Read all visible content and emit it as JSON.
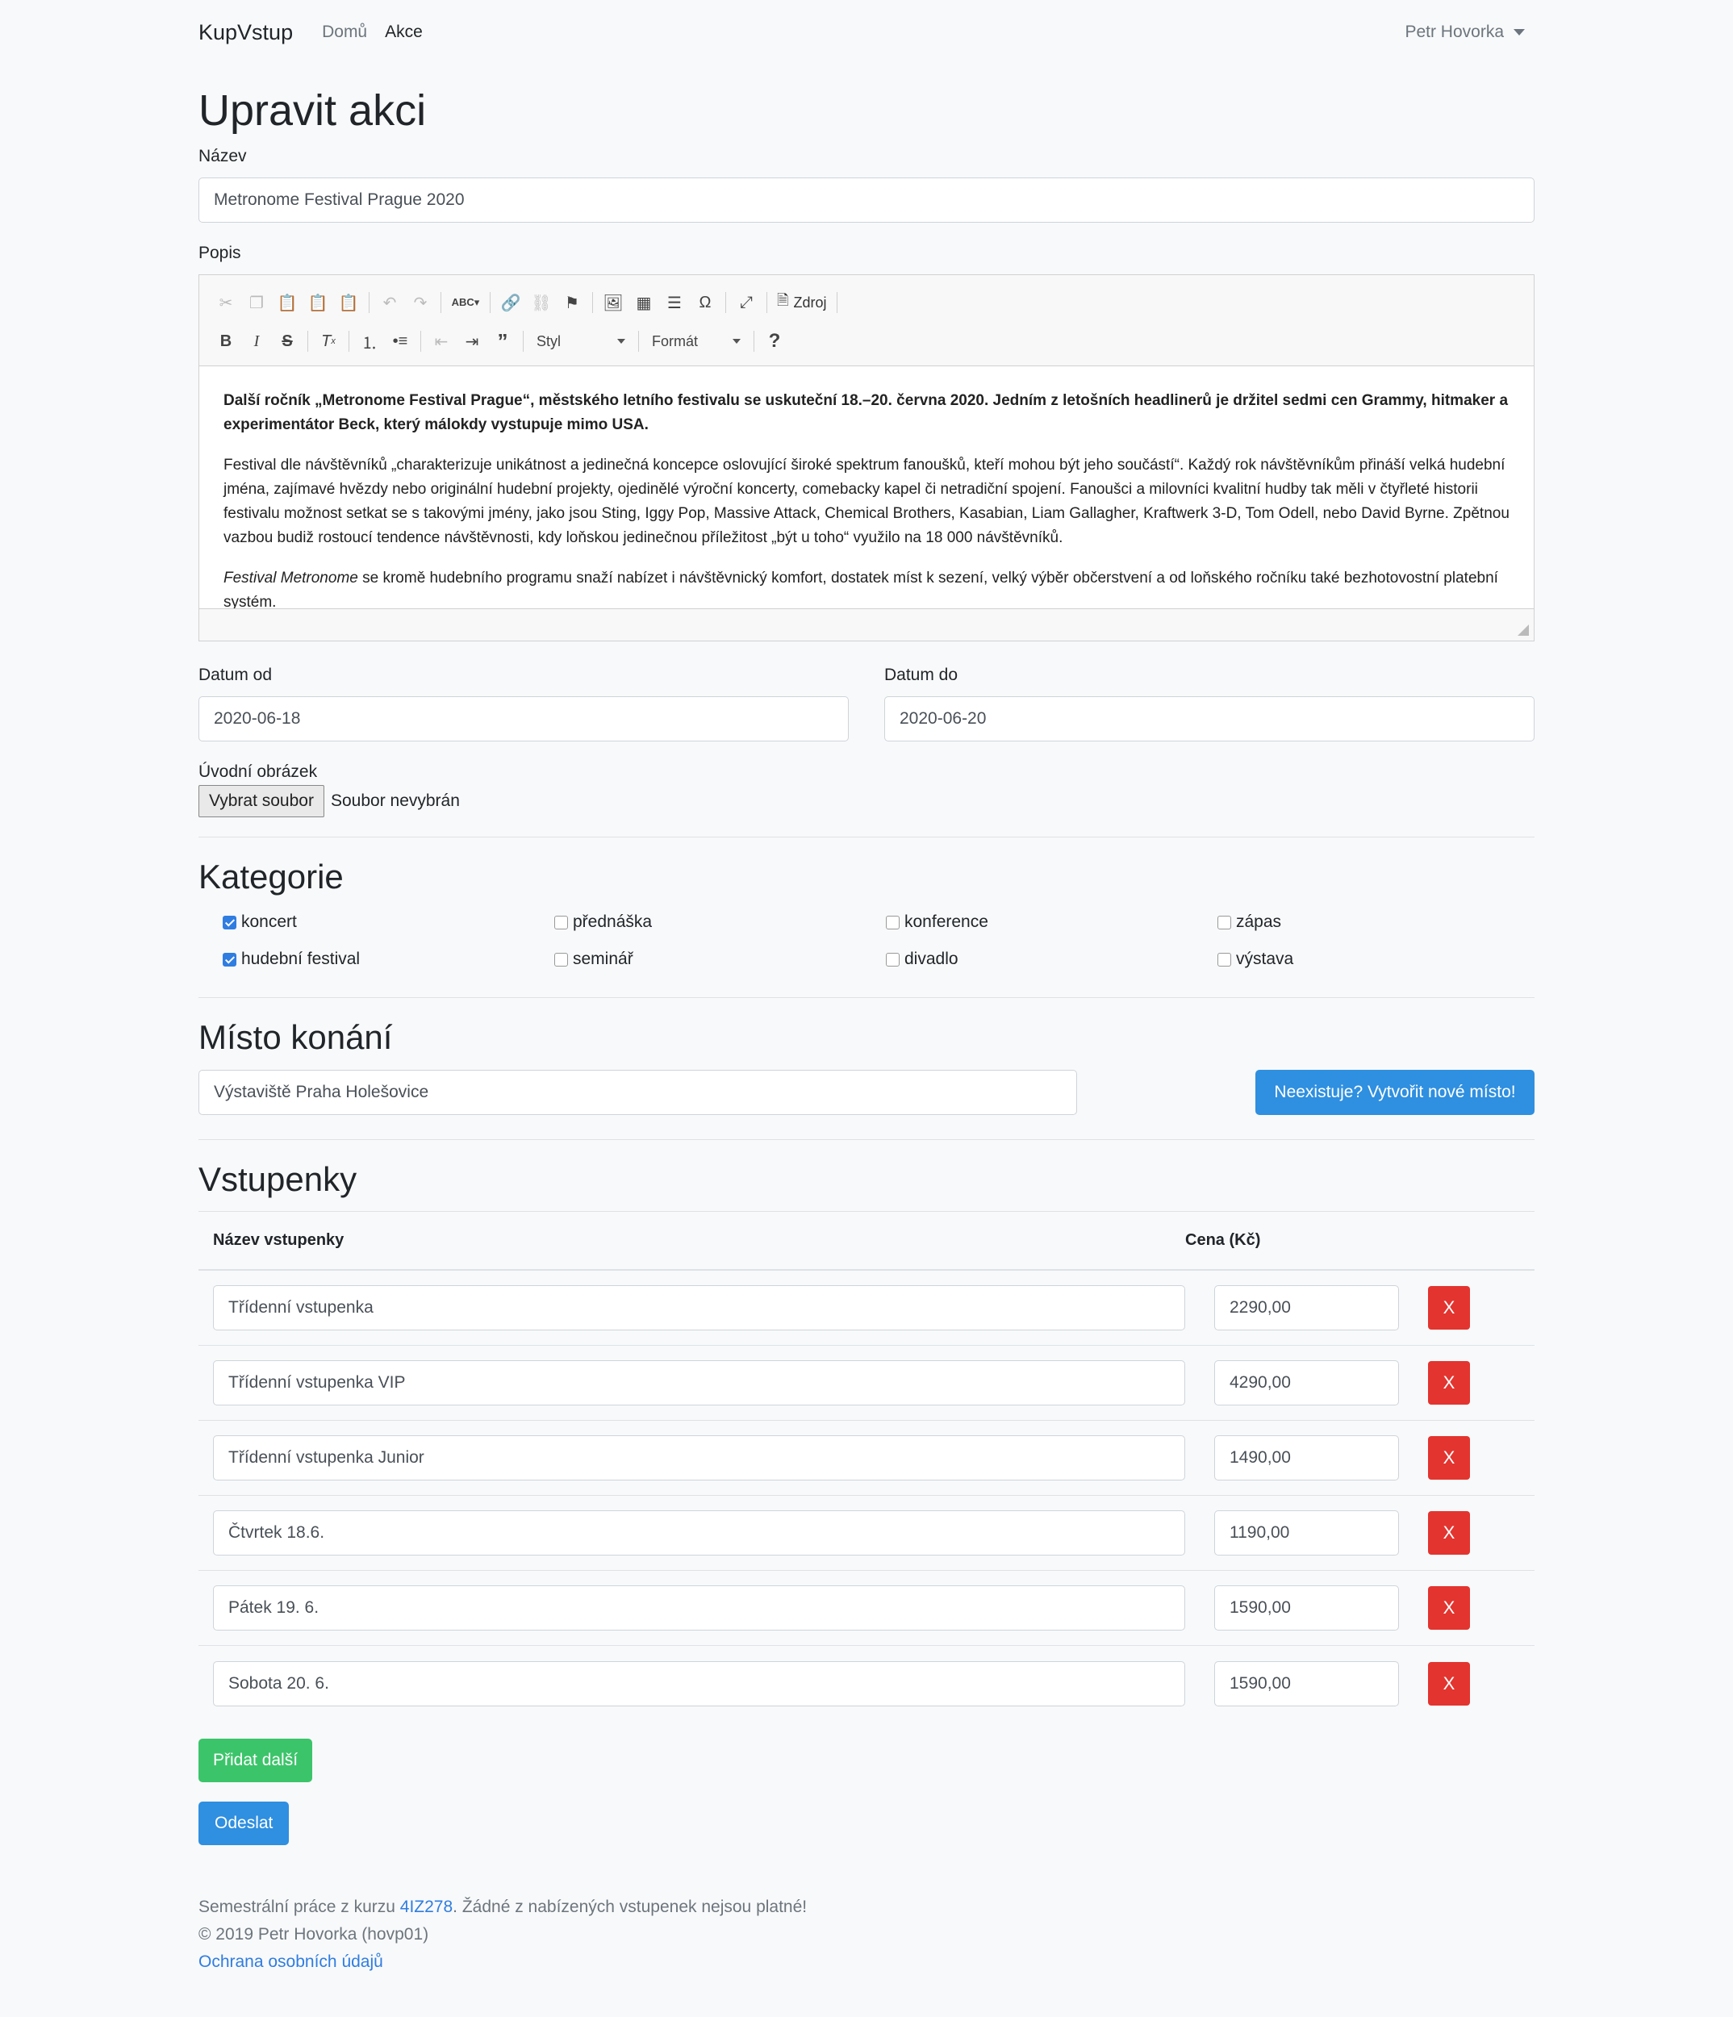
{
  "navbar": {
    "brand": "KupVstup",
    "links": [
      "Domů",
      "Akce"
    ],
    "user": "Petr Hovorka"
  },
  "page": {
    "title": "Upravit akci"
  },
  "form": {
    "name_label": "Název",
    "name_value": "Metronome Festival Prague 2020",
    "description_label": "Popis",
    "editor": {
      "toolbar_source": "Zdroj",
      "toolbar_style": "Styl",
      "toolbar_format": "Formát",
      "paragraphs": [
        "Další ročník „Metronome Festival Prague“, městského letního festivalu se uskuteční 18.–20. června 2020. Jedním z letošních headlinerů je držitel sedmi cen Grammy, hitmaker a experimentátor Beck, který málokdy vystupuje mimo USA.",
        "Festival dle návštěvníků „charakterizuje unikátnost a jedinečná koncepce oslovující široké spektrum fanoušků, kteří mohou být jeho součástí“. Každý rok návštěvníkům přináší velká hudební jména, zajímavé hvězdy nebo originální hudební projekty, ojedinělé výroční koncerty, comebacky kapel či netradiční spojení. Fanoušci a milovníci kvalitní hudby tak měli v čtyřleté historii festivalu možnost setkat se s takovými jmény, jako jsou Sting, Iggy Pop, Massive Attack, Chemical Brothers, Kasabian, Liam Gallagher, Kraftwerk 3-D, Tom Odell, nebo David Byrne. Zpětnou vazbou budiž rostoucí tendence návštěvnosti, kdy loňskou jedinečnou příležitost „být u toho“ využilo na 18 000 návštěvníků.",
        "Festival Metronome",
        " se kromě hudebního programu snaží nabízet i návštěvnický komfort, dostatek míst k sezení, velký výběr občerstvení a od loňského ročníku také bezhotovostní platební systém."
      ]
    },
    "date_from_label": "Datum od",
    "date_from_value": "2020-06-18",
    "date_to_label": "Datum do",
    "date_to_value": "2020-06-20",
    "image_label": "Úvodní obrázek",
    "file_button": "Vybrat soubor",
    "file_status": "Soubor nevybrán"
  },
  "categories": {
    "title": "Kategorie",
    "items": [
      {
        "label": "koncert",
        "checked": true
      },
      {
        "label": "přednáška",
        "checked": false
      },
      {
        "label": "konference",
        "checked": false
      },
      {
        "label": "zápas",
        "checked": false
      },
      {
        "label": "hudební festival",
        "checked": true
      },
      {
        "label": "seminář",
        "checked": false
      },
      {
        "label": "divadlo",
        "checked": false
      },
      {
        "label": "výstava",
        "checked": false
      }
    ]
  },
  "place": {
    "title": "Místo konání",
    "value": "Výstaviště Praha Holešovice",
    "create_button": "Neexistuje? Vytvořit nové místo!"
  },
  "tickets": {
    "title": "Vstupenky",
    "col_name": "Název vstupenky",
    "col_price": "Cena (Kč)",
    "delete_label": "X",
    "rows": [
      {
        "name": "Třídenní vstupenka",
        "price": "2290,00"
      },
      {
        "name": "Třídenní vstupenka VIP",
        "price": "4290,00"
      },
      {
        "name": "Třídenní vstupenka Junior",
        "price": "1490,00"
      },
      {
        "name": "Čtvrtek 18.6.",
        "price": "1190,00"
      },
      {
        "name": "Pátek 19. 6.",
        "price": "1590,00"
      },
      {
        "name": "Sobota 20. 6.",
        "price": "1590,00"
      }
    ],
    "add_button": "Přidat další",
    "submit_button": "Odeslat"
  },
  "footer": {
    "line1_prefix": "Semestrální práce z kurzu ",
    "course_link": "4IZ278",
    "line1_suffix": ". Žádné z nabízených vstupenek nejsou platné!",
    "line2": "© 2019 Petr Hovorka (hovp01)",
    "privacy_link": "Ochrana osobních údajů"
  }
}
